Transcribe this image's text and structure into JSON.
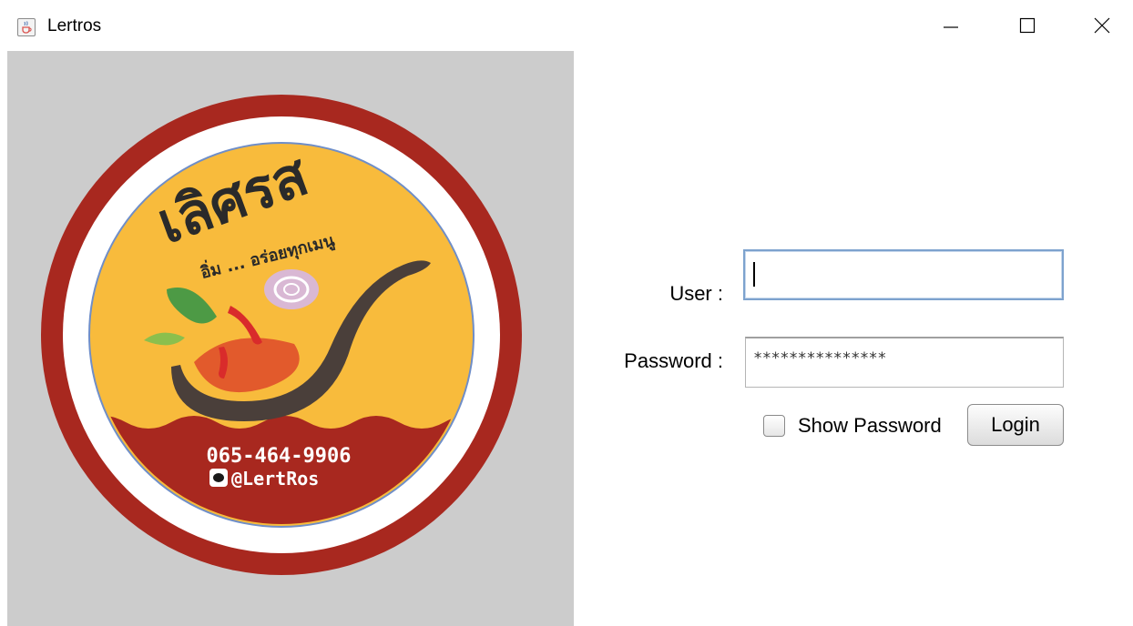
{
  "window": {
    "title": "Lertros",
    "app_icon": "java-cup-icon",
    "controls": {
      "minimize": "minimize-icon",
      "maximize": "maximize-icon",
      "close": "close-icon"
    }
  },
  "logo": {
    "brand_thai": "เลิศรส",
    "tagline_thai": "อิ่ม ... อร่อยทุกเมนู",
    "phone": "065-464-9906",
    "line_handle": "@LertRos",
    "colors": {
      "ring": "#a8281f",
      "inner": "#f8bb3c",
      "band": "#a8281f",
      "panel": "#cccccc"
    }
  },
  "form": {
    "user_label": "User :",
    "user_value": "",
    "password_label": "Password :",
    "password_value": "***************",
    "show_password_label": "Show Password",
    "show_password_checked": false,
    "login_label": "Login"
  }
}
